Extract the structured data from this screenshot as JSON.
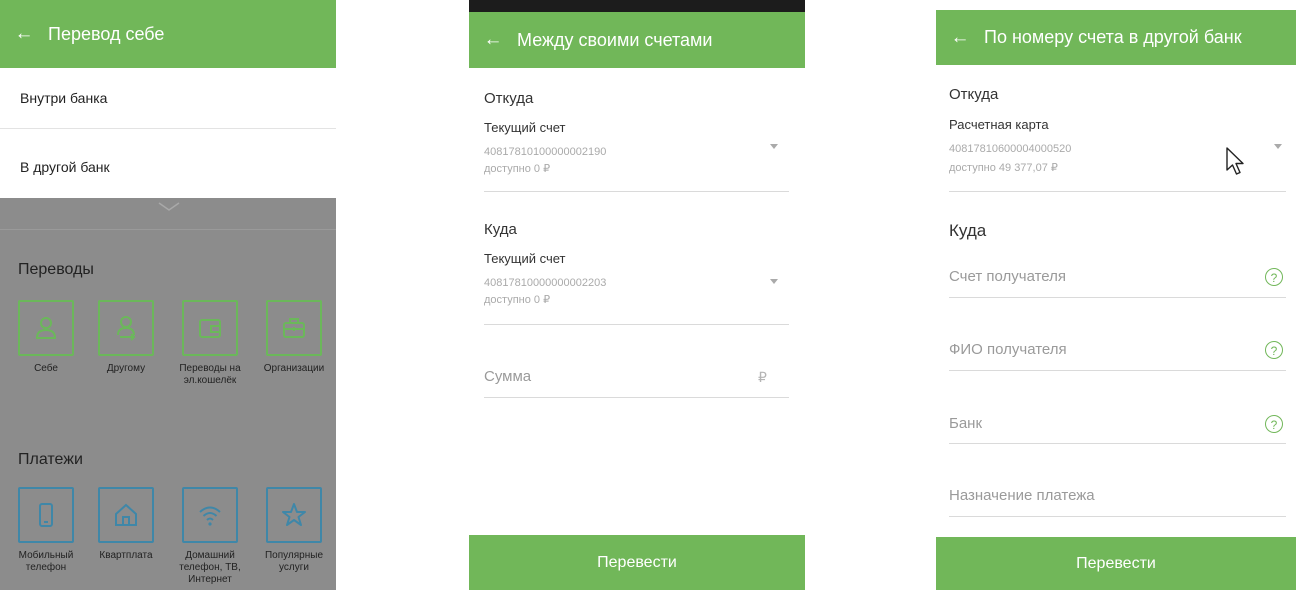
{
  "screen1": {
    "title": "Перевод себе",
    "menu": [
      "Внутри банка",
      "В другой банк"
    ],
    "transfers_title": "Переводы",
    "transfers": [
      {
        "label": "Себе",
        "icon": "person-icon"
      },
      {
        "label": "Другому",
        "icon": "person-transfer-icon"
      },
      {
        "label": "Переводы на эл.кошелёк",
        "icon": "wallet-icon"
      },
      {
        "label": "Организации",
        "icon": "briefcase-icon"
      }
    ],
    "payments_title": "Платежи",
    "payments": [
      {
        "label": "Мобильный телефон",
        "icon": "phone-icon"
      },
      {
        "label": "Квартплата",
        "icon": "home-icon"
      },
      {
        "label": "Домашний телефон, ТВ, Интернет",
        "icon": "wifi-icon"
      },
      {
        "label": "Популярные услуги",
        "icon": "star-icon"
      }
    ]
  },
  "screen2": {
    "title": "Между своими счетами",
    "from_label": "Откуда",
    "from_account_type": "Текущий счет",
    "from_account_number": "40817810100000002190",
    "from_available": "доступно 0 ₽",
    "to_label": "Куда",
    "to_account_type": "Текущий счет",
    "to_account_number": "40817810000000002203",
    "to_available": "доступно 0 ₽",
    "amount_placeholder": "Сумма",
    "currency_symbol": "₽",
    "submit_label": "Перевести"
  },
  "screen3": {
    "title": "По номеру счета в другой банк",
    "from_label": "Откуда",
    "from_account_type": "Расчетная карта",
    "from_account_number": "40817810600004000520",
    "from_available": "доступно 49 377,07 ₽",
    "to_label": "Куда",
    "fields": [
      "Счет получателя",
      "ФИО получателя",
      "Банк",
      "Назначение платежа"
    ],
    "help_symbol": "?",
    "submit_label": "Перевести"
  },
  "colors": {
    "accent": "#71b759",
    "overlay": "#8c8c8c",
    "payment_icon": "#3f87a8"
  }
}
